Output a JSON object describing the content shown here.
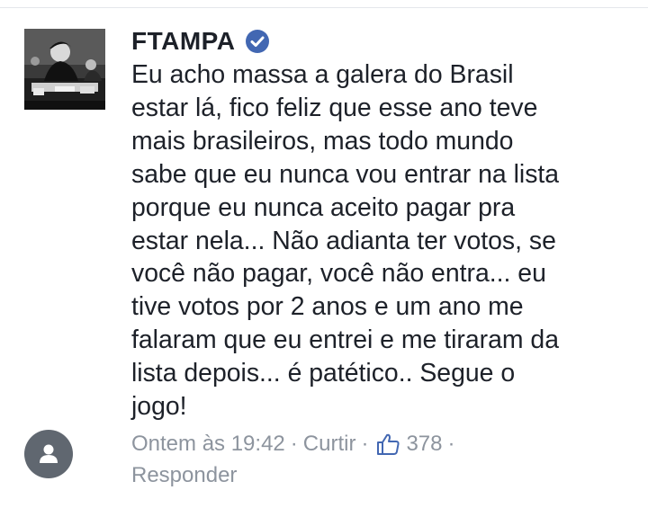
{
  "comment": {
    "author": "FTAMPA",
    "verified": true,
    "lines": [
      "Eu acho massa a galera do Brasil",
      "estar lá, fico feliz que esse ano teve",
      "mais brasileiros, mas todo mundo",
      "sabe que eu nunca vou entrar na lista",
      "porque eu nunca aceito pagar pra",
      "estar nela... Não adianta ter votos, se",
      "você não pagar, você não entra... eu",
      "tive votos por 2 anos e um ano me",
      "falaram que eu entrei e me tiraram da",
      "lista depois... é patético.. Segue o",
      "jogo!"
    ],
    "timestamp": "Ontem às 19:42",
    "like_label": "Curtir",
    "like_count": "378",
    "reply_label": "Responder",
    "separator": "·"
  },
  "colors": {
    "text": "#1d2129",
    "meta": "#8d949e",
    "verified_badge": "#4267b2",
    "like_icon": "#4267b2",
    "user_avatar_bg": "#606770"
  },
  "icons": {
    "verified": "verified-badge-icon",
    "like": "thumbs-up-icon",
    "user": "user-silhouette-icon"
  }
}
